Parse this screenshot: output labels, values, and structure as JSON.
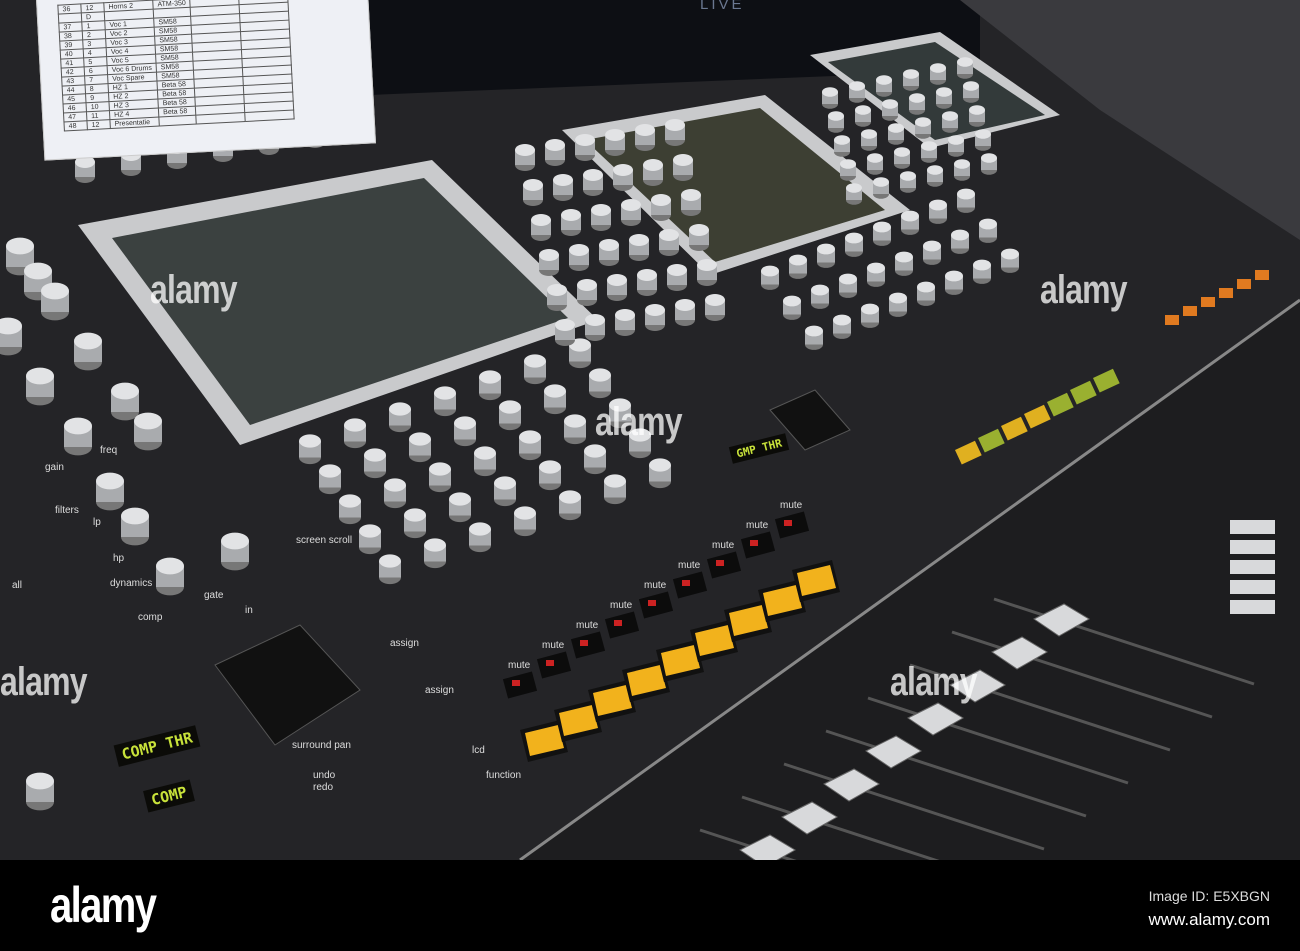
{
  "watermark": {
    "logo": "alamy",
    "overlay": "alamy",
    "image_id": "Image ID: E5XBGN",
    "site": "www.alamy.com"
  },
  "console": {
    "brand_display": "LIVE",
    "lcd_1": "COMP THR",
    "lcd_2": "COMP",
    "lcd_3": "GMP THR",
    "labels": {
      "surround_pan": "surround pan",
      "undo": "undo",
      "redo": "redo",
      "assign": "assign",
      "mute": "mute",
      "lcd": "lcd",
      "function": "function",
      "screen_scroll": "screen scroll",
      "dynamics": "dynamics",
      "comp": "comp",
      "gate": "gate",
      "filters": "filters",
      "lp": "lp",
      "hp": "hp",
      "in": "in",
      "gain": "gain",
      "freq": "freq",
      "all": "all"
    }
  },
  "sheet_rows": [
    [
      "36",
      "12",
      "Horns 2",
      "ATM-350"
    ],
    [
      "",
      "D",
      "",
      ""
    ],
    [
      "37",
      "1",
      "Voc 1",
      "SM58"
    ],
    [
      "38",
      "2",
      "Voc 2",
      "SM58"
    ],
    [
      "39",
      "3",
      "Voc 3",
      "SM58"
    ],
    [
      "40",
      "4",
      "Voc 4",
      "SM58"
    ],
    [
      "41",
      "5",
      "Voc 5",
      "SM58"
    ],
    [
      "42",
      "6",
      "Voc 6 Drums",
      "SM58"
    ],
    [
      "43",
      "7",
      "Voc Spare",
      "SM58"
    ],
    [
      "44",
      "8",
      "HZ 1",
      "Beta 58"
    ],
    [
      "45",
      "9",
      "HZ 2",
      "Beta 58"
    ],
    [
      "46",
      "10",
      "HZ 3",
      "Beta 58"
    ],
    [
      "47",
      "11",
      "HZ 4",
      "Beta 58"
    ],
    [
      "48",
      "12",
      "Presentatie",
      ""
    ]
  ],
  "colors": {
    "panel": "#2a2a2c",
    "screen_frame": "#c9cacc",
    "button_yellow": "#f2b21c",
    "lcd_text": "#c8e23a"
  }
}
